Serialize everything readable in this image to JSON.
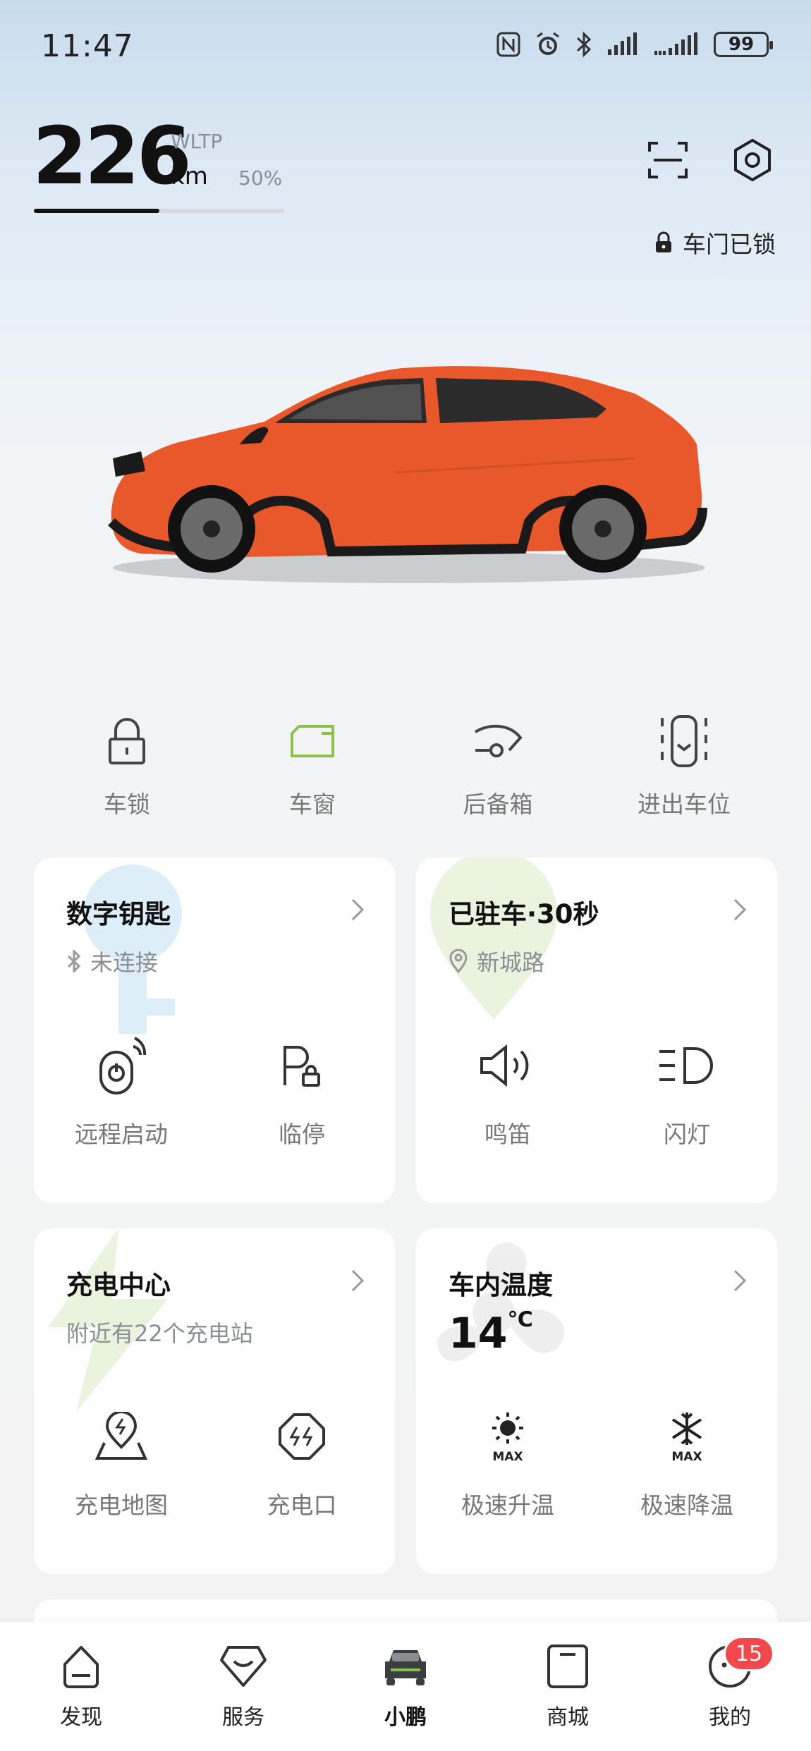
{
  "status_bar": {
    "time": "11:47",
    "battery": "99",
    "icons": [
      "nfc-icon",
      "alarm-icon",
      "bluetooth-icon",
      "signal-icon",
      "signal-icon-2",
      "battery-icon"
    ]
  },
  "range": {
    "value": "226",
    "standard": "WLTP",
    "unit": "km",
    "percent_label": "50%",
    "percent": 0.5
  },
  "door_status": "车门已锁",
  "quick_controls": [
    {
      "label": "车锁",
      "icon": "lock-icon"
    },
    {
      "label": "车窗",
      "icon": "window-icon"
    },
    {
      "label": "后备箱",
      "icon": "trunk-icon"
    },
    {
      "label": "进出车位",
      "icon": "parking-icon"
    }
  ],
  "cards": {
    "digital_key": {
      "title": "数字钥匙",
      "status": "未连接",
      "actions": [
        {
          "label": "远程启动",
          "icon": "remote-start-icon"
        },
        {
          "label": "临停",
          "icon": "temp-park-icon"
        }
      ]
    },
    "parked": {
      "title": "已驻车·30秒",
      "location": "新城路",
      "actions": [
        {
          "label": "鸣笛",
          "icon": "horn-icon"
        },
        {
          "label": "闪灯",
          "icon": "flash-lights-icon"
        }
      ]
    },
    "charging": {
      "title": "充电中心",
      "subtitle": "附近有22个充电站",
      "actions": [
        {
          "label": "充电地图",
          "icon": "charge-map-icon"
        },
        {
          "label": "充电口",
          "icon": "charge-port-icon"
        }
      ]
    },
    "cabin_temp": {
      "title": "车内温度",
      "value": "14",
      "unit": "℃",
      "actions": [
        {
          "label": "极速升温",
          "icon": "max-heat-icon"
        },
        {
          "label": "极速降温",
          "icon": "max-cool-icon"
        }
      ]
    }
  },
  "bottom_nav": [
    {
      "label": "发现",
      "icon": "discover-icon"
    },
    {
      "label": "服务",
      "icon": "service-icon"
    },
    {
      "label": "小鹏",
      "icon": "car-icon",
      "active": true
    },
    {
      "label": "商城",
      "icon": "shop-icon"
    },
    {
      "label": "我的",
      "icon": "profile-icon",
      "badge": "15"
    }
  ],
  "colors": {
    "accent_green": "#8bc34a",
    "car_orange": "#e8582a",
    "badge_red": "#f0484c"
  }
}
